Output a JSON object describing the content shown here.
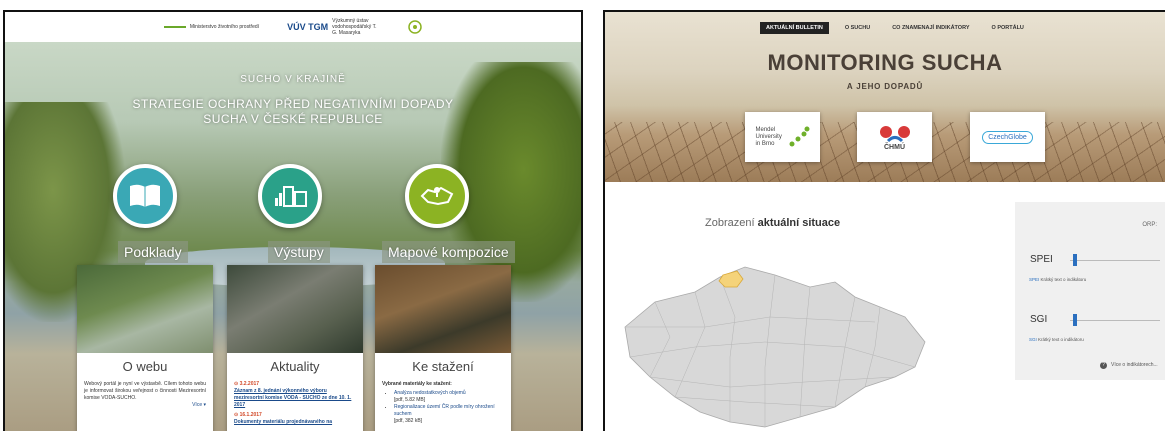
{
  "left": {
    "header_logos": [
      {
        "name": "ministry-logo",
        "text": "Ministerstvo životního prostředí"
      },
      {
        "name": "vuv-logo",
        "mark": "VÚV TGM",
        "text": "Výzkumný ústav vodohospodářský T. G. Masaryka"
      },
      {
        "name": "third-logo",
        "text": ""
      }
    ],
    "hero_title": "SUCHO V KRAJINĚ",
    "hero_subtitle": "STRATEGIE OCHRANY PŘED NEGATIVNÍMI DOPADY SUCHA V ČESKÉ REPUBLICE",
    "nav_circles": [
      {
        "label": "Podklady",
        "icon": "book-icon",
        "color": "#3aa8b5"
      },
      {
        "label": "Výstupy",
        "icon": "charts-documents-icon",
        "color": "#2aa189"
      },
      {
        "label": "Mapové kompozice",
        "icon": "map-pin-icon",
        "color": "#8cb323"
      }
    ],
    "cards": {
      "about": {
        "title": "O webu",
        "text": "Webový portál je nyní ve výstavbě. Cílem tohoto webu je informovat širokou veřejnost o činnosti Meziresortní komise VODA-SUCHO.",
        "more": "Více ▾"
      },
      "news": {
        "title": "Aktuality",
        "items": [
          {
            "date": "3.2.2017",
            "text": "Záznam z 8. jednání výkonného výboru meziresortní komise VODA - SUCHO ze dne 10. 1. 2017"
          },
          {
            "date": "16.1.2017",
            "text": "Dokumenty materiálu projednávaného na"
          }
        ]
      },
      "download": {
        "title": "Ke stažení",
        "intro": "Vybrané materiály ke stažení:",
        "items": [
          {
            "text": "Analýza nedostatkových objemů",
            "meta": "[pdf, 5.82 MB]"
          },
          {
            "text": "Regionalizace území ČR podle míry ohrožení suchem",
            "meta": "[pdf, 382 kB]"
          }
        ]
      }
    }
  },
  "right": {
    "nav": [
      "AKTUÁLNÍ BULLETIN",
      "O SUCHU",
      "CO ZNAMENAJÍ INDIKÁTORY",
      "O PORTÁLU"
    ],
    "nav_active": 0,
    "title": "MONITORING SUCHA",
    "subtitle": "A JEHO DOPADŮ",
    "partners": [
      "Mendel University in Brno",
      "ČHMÚ",
      "CzechGlobe"
    ],
    "section_label": "Zobrazení",
    "section_label_bold": "aktuální situace",
    "panel": {
      "orp_label": "ORP:",
      "indicators": [
        {
          "name": "SPEI",
          "level": 0.04,
          "short": "SPEI",
          "desc": "Krátký text o indikátoru"
        },
        {
          "name": "SGI",
          "level": 0.04,
          "short": "SGI",
          "desc": "Krátký text o indikátoru"
        }
      ],
      "more": "Více o indikátorech..."
    }
  }
}
